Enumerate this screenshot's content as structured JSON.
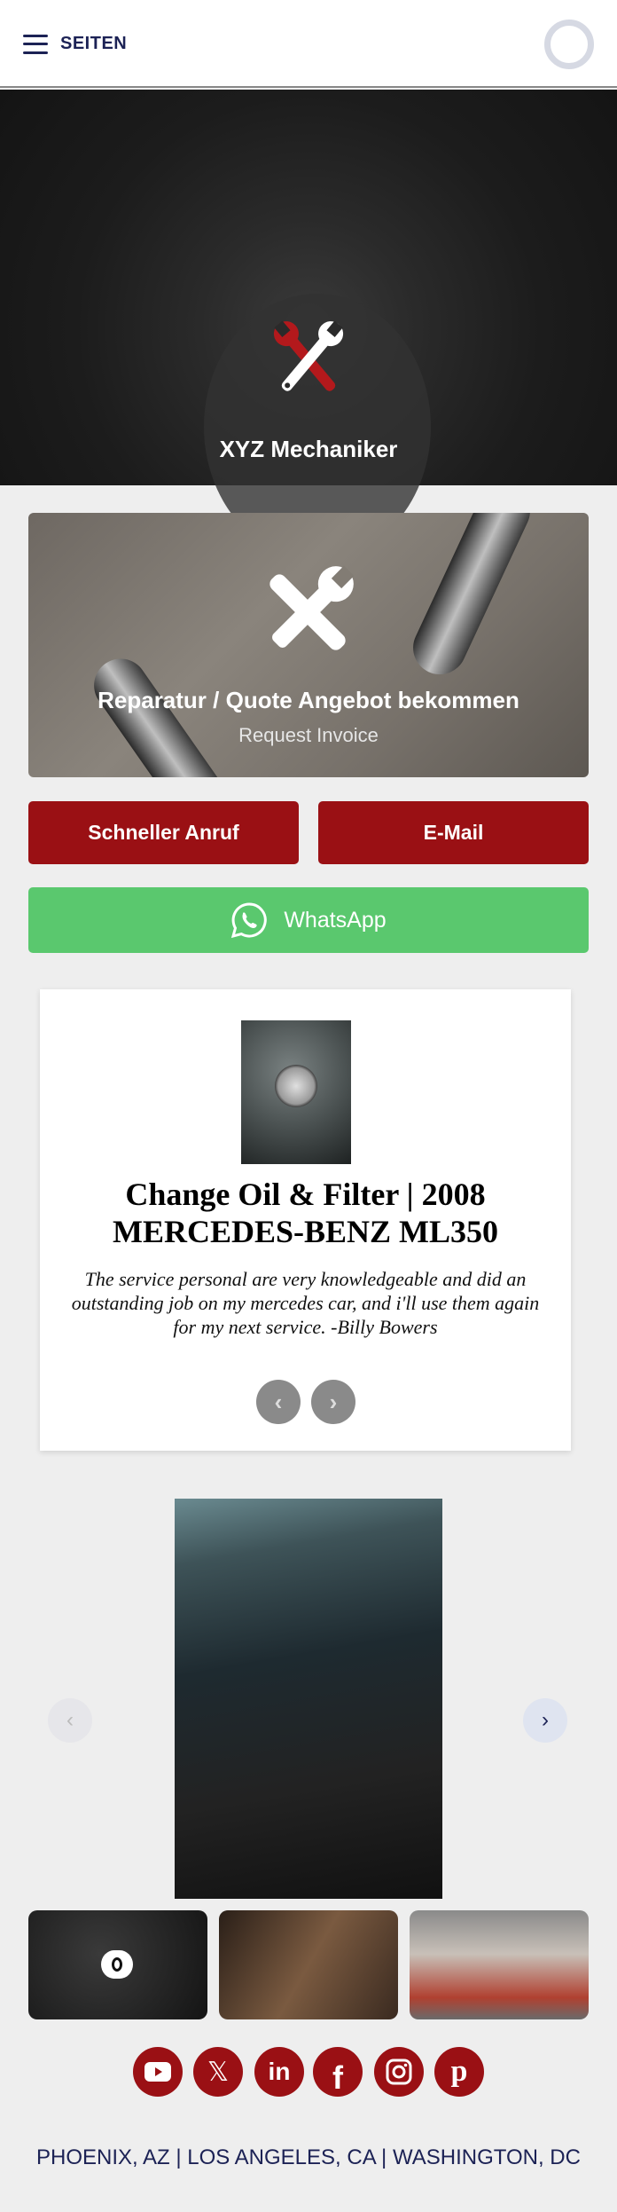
{
  "header": {
    "menu_label": "SEITEN"
  },
  "hero": {
    "title": "XYZ Mechaniker"
  },
  "quote_card": {
    "title": "Reparatur / Quote Angebot bekommen",
    "subtitle": "Request Invoice"
  },
  "buttons": {
    "call": "Schneller Anruf",
    "email": "E-Mail",
    "whatsapp": "WhatsApp"
  },
  "testimonial": {
    "title": "Change Oil & Filter | 2008 MERCEDES-BENZ ML350",
    "quote": "The service personal are very knowledgeable and did an outstanding job on my mercedes car, and i'll use them again for my next service. -Billy Bowers",
    "prev": "‹",
    "next": "›"
  },
  "gallery": {
    "prev": "‹",
    "next": "›"
  },
  "social": [
    "youtube-icon",
    "x-icon",
    "linkedin-icon",
    "facebook-icon",
    "instagram-icon",
    "pinterest-icon"
  ],
  "footer": {
    "locations": "PHOENIX, AZ | LOS ANGELES, CA | WASHINGTON, DC"
  },
  "colors": {
    "brand_red": "#9a1014",
    "whatsapp_green": "#5ac86e",
    "navy": "#1c2255"
  }
}
